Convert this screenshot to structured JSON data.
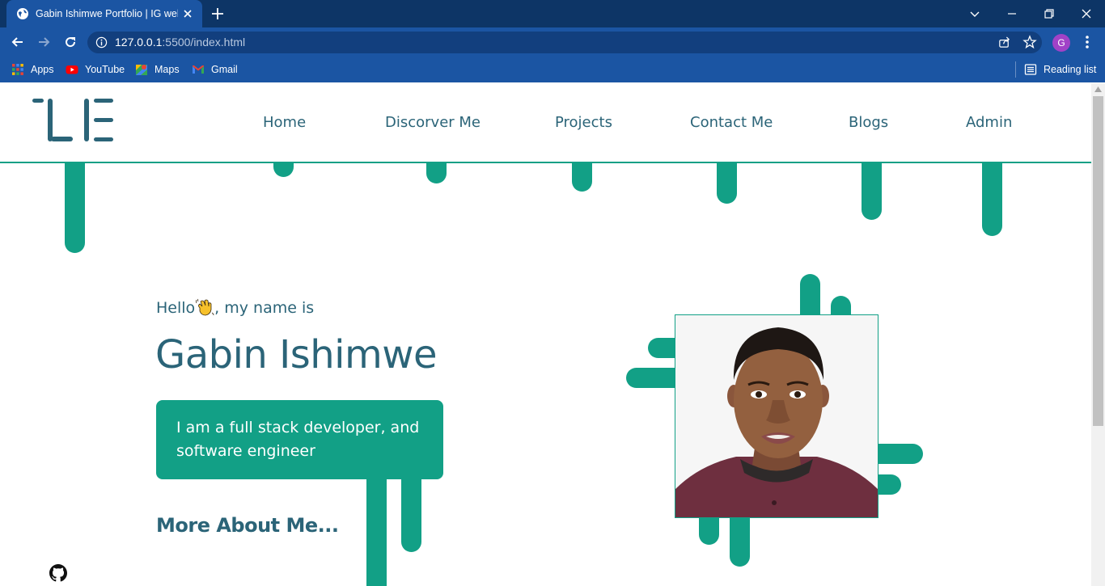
{
  "browser": {
    "tab_title": "Gabin Ishimwe Portfolio | IG welcome",
    "url_host": "127.0.0.1",
    "url_path": ":5500/index.html",
    "profile_initial": "G",
    "bookmarks": [
      {
        "label": "Apps",
        "icon": "apps-grid-icon"
      },
      {
        "label": "YouTube",
        "icon": "youtube-icon"
      },
      {
        "label": "Maps",
        "icon": "maps-icon"
      },
      {
        "label": "Gmail",
        "icon": "gmail-icon"
      }
    ],
    "reading_list": "Reading list"
  },
  "site": {
    "logo_text": "IE",
    "nav": [
      {
        "label": "Home"
      },
      {
        "label": "Discorver Me"
      },
      {
        "label": "Projects"
      },
      {
        "label": "Contact Me"
      },
      {
        "label": "Blogs"
      },
      {
        "label": "Admin"
      }
    ],
    "hero": {
      "greeting_before": "Hello",
      "greeting_after": ", my name is",
      "name": "Gabin Ishimwe",
      "intro": "I am a full stack developer, and software engineer",
      "more_link": "More About Me..."
    }
  },
  "colors": {
    "accent": "#12a086",
    "text": "#2b6478",
    "chrome_tabbar": "#0d3566",
    "chrome_toolbar": "#1b55a3"
  }
}
